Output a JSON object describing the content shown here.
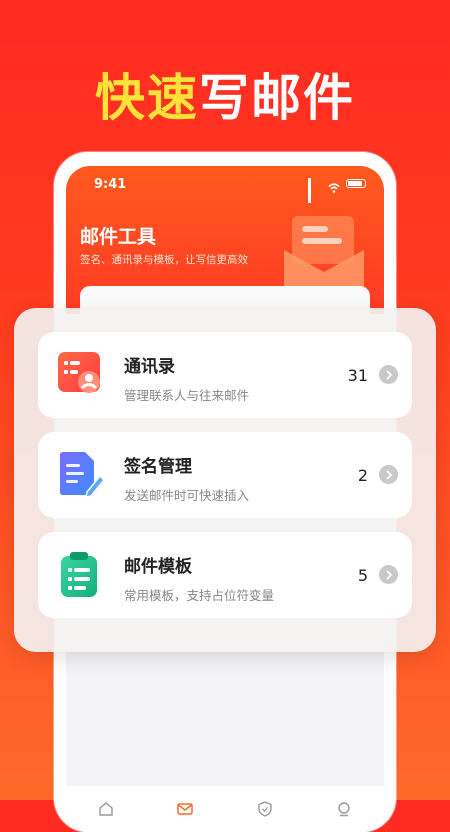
{
  "headline": {
    "part1": "快速",
    "part2": "写邮件"
  },
  "status": {
    "time": "9:41"
  },
  "app": {
    "title": "邮件工具",
    "subtitle": "签名、通讯录与模板，让写信更高效"
  },
  "cards": [
    {
      "title": "通讯录",
      "desc": "管理联系人与往来邮件",
      "count": "31",
      "icon": "contacts-icon"
    },
    {
      "title": "签名管理",
      "desc": "发送邮件时可快速插入",
      "count": "2",
      "icon": "signature-icon"
    },
    {
      "title": "邮件模板",
      "desc": "常用模板，支持占位符变量",
      "count": "5",
      "icon": "template-icon"
    }
  ],
  "tabs": [
    "home-icon",
    "mail-icon",
    "shield-icon",
    "profile-icon"
  ],
  "colors": {
    "accent": "#ff3b25",
    "headline_yellow": "#ffe33a"
  }
}
